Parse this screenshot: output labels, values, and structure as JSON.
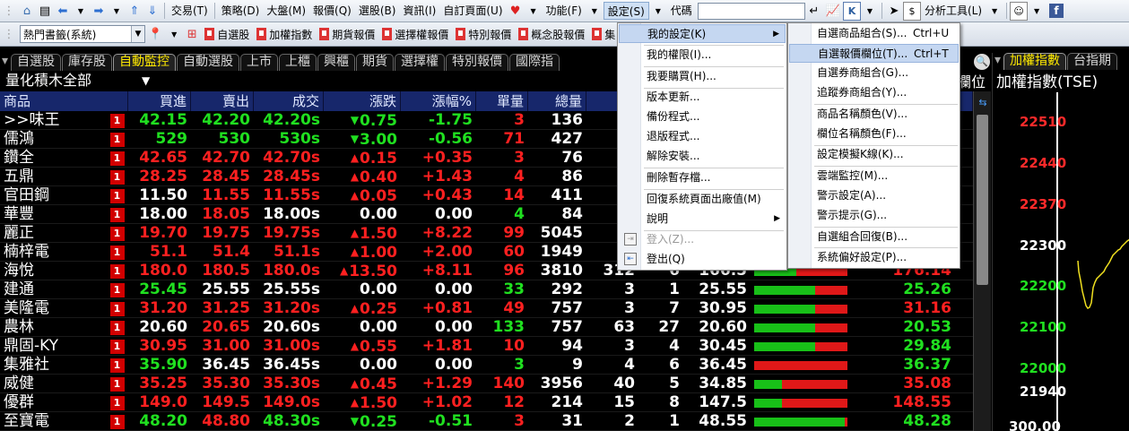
{
  "toolbar1": {
    "menus": [
      "交易(T)",
      "策略(D)",
      "大盤(M)",
      "報價(Q)",
      "選股(B)",
      "資訊(I)",
      "自訂頁面(U)",
      "功能(F)",
      "設定(S)"
    ],
    "code_label": "代碼",
    "analysis_label": "分析工具(L)"
  },
  "toolbar2": {
    "combo_value": "熱門書籤(系統)",
    "quick_links": [
      "自選股",
      "加權指數",
      "期貨報價",
      "選擇權報價",
      "特別報價",
      "概念股報價",
      "集"
    ]
  },
  "tabs": [
    "自選股",
    "庫存股",
    "自動監控",
    "自動選股",
    "上市",
    "上櫃",
    "興櫃",
    "期貨",
    "選擇權",
    "特別報價",
    "國際指"
  ],
  "active_tab": "自動監控",
  "group_title": "量化積木全部",
  "header_cols": [
    "商品",
    "買進",
    "賣出",
    "成交",
    "漲跌",
    "漲幅%",
    "單量",
    "總量"
  ],
  "header_right": "欄位",
  "rows": [
    {
      "name": ">>味王",
      "bid": "42.15",
      "ask": "42.20",
      "last": "42.20s",
      "chg": "0.75",
      "dir": "down",
      "pct": "-1.75",
      "vol": "3",
      "tot": "136",
      "c8": "",
      "c9": "",
      "c10": "",
      "bar_green": 0.55,
      "lastv": ""
    },
    {
      "name": "儒鴻",
      "bid": "529",
      "ask": "530",
      "last": "530s",
      "chg": "3.00",
      "dir": "down",
      "pct": "-0.56",
      "vol": "71",
      "tot": "427",
      "c8": "",
      "c9": "",
      "c10": "",
      "bar_green": 0.55,
      "lastv": ""
    },
    {
      "name": "鑽全",
      "bid": "42.65",
      "ask": "42.70",
      "last": "42.70s",
      "chg": "0.15",
      "dir": "up",
      "pct": "+0.35",
      "vol": "3",
      "tot": "76",
      "c8": "",
      "c9": "",
      "c10": "",
      "bar_green": 0.55,
      "lastv": ""
    },
    {
      "name": "五鼎",
      "bid": "28.25",
      "ask": "28.45",
      "last": "28.45s",
      "chg": "0.40",
      "dir": "up",
      "pct": "+1.43",
      "vol": "4",
      "tot": "86",
      "c8": "",
      "c9": "",
      "c10": "",
      "bar_green": 0.55,
      "lastv": ""
    },
    {
      "name": "官田鋼",
      "bid": "11.50",
      "ask": "11.55",
      "last": "11.55s",
      "chg": "0.05",
      "dir": "up",
      "pct": "+0.43",
      "vol": "14",
      "tot": "411",
      "c8": "",
      "c9": "",
      "c10": "",
      "bar_green": 0.55,
      "lastv": ""
    },
    {
      "name": "華豐",
      "bid": "18.00",
      "ask": "18.05",
      "last": "18.00s",
      "chg": "0.00",
      "dir": "flat",
      "pct": "0.00",
      "vol": "4",
      "tot": "84",
      "c8": "",
      "c9": "",
      "c10": "",
      "bar_green": 0.55,
      "lastv": ""
    },
    {
      "name": "麗正",
      "bid": "19.70",
      "ask": "19.75",
      "last": "19.75s",
      "chg": "1.50",
      "dir": "up",
      "pct": "+8.22",
      "vol": "99",
      "tot": "5045",
      "c8": "",
      "c9": "",
      "c10": "",
      "bar_green": 0.55,
      "lastv": ""
    },
    {
      "name": "楠梓電",
      "bid": "51.1",
      "ask": "51.4",
      "last": "51.1s",
      "chg": "1.00",
      "dir": "up",
      "pct": "+2.00",
      "vol": "60",
      "tot": "1949",
      "c8": "",
      "c9": "",
      "c10": "",
      "bar_green": 0.55,
      "lastv": ""
    },
    {
      "name": "海悅",
      "bid": "180.0",
      "ask": "180.5",
      "last": "180.0s",
      "chg": "13.50",
      "dir": "up",
      "pct": "+8.11",
      "vol": "96",
      "tot": "3810",
      "c8": "312",
      "c9": "6",
      "c10": "166.5",
      "bar_green": 0.45,
      "lastv": "176.14"
    },
    {
      "name": "建通",
      "bid": "25.45",
      "ask": "25.55",
      "last": "25.55s",
      "chg": "0.00",
      "dir": "flat",
      "pct": "0.00",
      "vol": "33",
      "tot": "292",
      "c8": "3",
      "c9": "1",
      "c10": "25.55",
      "bar_green": 0.65,
      "lastv": "25.26"
    },
    {
      "name": "美隆電",
      "bid": "31.20",
      "ask": "31.25",
      "last": "31.20s",
      "chg": "0.25",
      "dir": "up",
      "pct": "+0.81",
      "vol": "49",
      "tot": "757",
      "c8": "3",
      "c9": "7",
      "c10": "30.95",
      "bar_green": 0.65,
      "lastv": "31.16"
    },
    {
      "name": "農林",
      "bid": "20.60",
      "ask": "20.65",
      "last": "20.60s",
      "chg": "0.00",
      "dir": "flat",
      "pct": "0.00",
      "vol": "133",
      "tot": "757",
      "c8": "63",
      "c9": "27",
      "c10": "20.60",
      "bar_green": 0.65,
      "lastv": "20.53"
    },
    {
      "name": "鼎固-KY",
      "bid": "30.95",
      "ask": "31.00",
      "last": "31.00s",
      "chg": "0.55",
      "dir": "up",
      "pct": "+1.81",
      "vol": "10",
      "tot": "94",
      "c8": "3",
      "c9": "4",
      "c10": "30.45",
      "bar_green": 0.65,
      "lastv": "29.84"
    },
    {
      "name": "集雅社",
      "bid": "35.90",
      "ask": "36.45",
      "last": "36.45s",
      "chg": "0.00",
      "dir": "flat",
      "pct": "0.00",
      "vol": "3",
      "tot": "9",
      "c8": "4",
      "c9": "6",
      "c10": "36.45",
      "bar_green": 0.0,
      "lastv": "36.37"
    },
    {
      "name": "威健",
      "bid": "35.25",
      "ask": "35.30",
      "last": "35.30s",
      "chg": "0.45",
      "dir": "up",
      "pct": "+1.29",
      "vol": "140",
      "tot": "3956",
      "c8": "40",
      "c9": "5",
      "c10": "34.85",
      "bar_green": 0.3,
      "lastv": "35.08"
    },
    {
      "name": "優群",
      "bid": "149.0",
      "ask": "149.5",
      "last": "149.0s",
      "chg": "1.50",
      "dir": "up",
      "pct": "+1.02",
      "vol": "12",
      "tot": "214",
      "c8": "15",
      "c9": "8",
      "c10": "147.5",
      "bar_green": 0.3,
      "lastv": "148.55"
    },
    {
      "name": "至寶電",
      "bid": "48.20",
      "ask": "48.80",
      "last": "48.30s",
      "chg": "0.25",
      "dir": "down",
      "pct": "-0.51",
      "vol": "3",
      "tot": "31",
      "c8": "2",
      "c9": "1",
      "c10": "48.55",
      "bar_green": 0.97,
      "lastv": "48.28"
    }
  ],
  "right_panel": {
    "tabs": [
      "加權指數",
      "台指期"
    ],
    "title": "加權指數(TSE)",
    "ticks": [
      "22510",
      "22440",
      "22370",
      "22300",
      "22200",
      "22100",
      "22000",
      "21940",
      "300.00"
    ]
  },
  "menu_settings": {
    "items": [
      {
        "label": "我的設定(K)",
        "submenu": true
      },
      {
        "label": "我的權限(I)..."
      },
      {
        "label": "我要購買(H)..."
      },
      {
        "label": "版本更新..."
      },
      {
        "label": "備份程式..."
      },
      {
        "label": "退版程式..."
      },
      {
        "label": "解除安裝..."
      },
      {
        "label": "刪除暫存檔..."
      },
      {
        "label": "回復系統頁面出廠值(M)"
      },
      {
        "label": "說明",
        "submenu": true
      },
      {
        "label": "登入(Z)...",
        "disabled": true
      },
      {
        "label": "登出(Q)"
      }
    ]
  },
  "menu_my_settings": {
    "items": [
      {
        "label": "自選商品組合(S)...",
        "shortcut": "Ctrl+U"
      },
      {
        "label": "自選報價欄位(T)...",
        "shortcut": "Ctrl+T"
      },
      {
        "label": "自選券商組合(G)..."
      },
      {
        "label": "追蹤券商組合(Y)..."
      },
      {
        "label": "商品名稱顏色(V)..."
      },
      {
        "label": "欄位名稱顏色(F)..."
      },
      {
        "label": "設定模擬K線(K)..."
      },
      {
        "label": "雲端監控(M)..."
      },
      {
        "label": "警示設定(A)..."
      },
      {
        "label": "警示提示(G)..."
      },
      {
        "label": "自選組合回復(B)..."
      },
      {
        "label": "系統偏好設定(P)..."
      }
    ]
  }
}
